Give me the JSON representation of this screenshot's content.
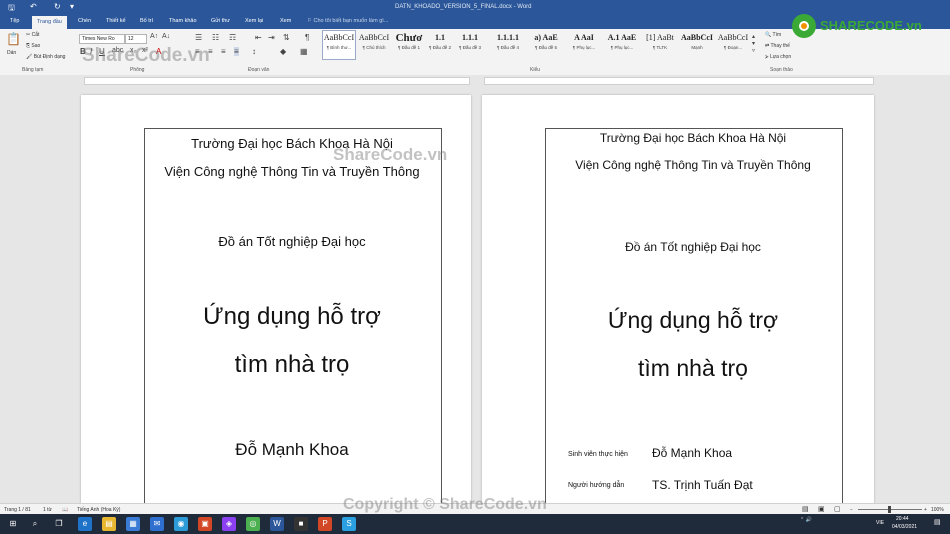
{
  "window": {
    "doc_title": "DATN_KHOADO_VERSION_5_FINAL.docx - Word"
  },
  "tabs": [
    "Tệp",
    "Trang đầu",
    "Chèn",
    "Thiết kế",
    "Bố trí",
    "Tham khảo",
    "Gửi thư",
    "Xem lại",
    "Xem"
  ],
  "active_tab": "Trang đầu",
  "tell_me": "Cho tôi biết bạn muốn làm gì...",
  "ribbon": {
    "clipboard": {
      "paste": "Dán",
      "cut": "Cắt",
      "copy": "Sao",
      "format_painter": "Bút Định dạng",
      "group": "Bảng tạm"
    },
    "font": {
      "name": "Times New Ro",
      "size": "12",
      "group": "Phông"
    },
    "paragraph": {
      "group": "Đoạn văn"
    },
    "styles": {
      "group": "Kiểu",
      "items": [
        {
          "sample": "AaBbCcI",
          "name": "¶ Bình thư..."
        },
        {
          "sample": "AaBbCcI",
          "name": "¶ Chú thích"
        },
        {
          "sample": "Chươ",
          "name": "¶ Đầu đề 1"
        },
        {
          "sample": "1.1",
          "name": "¶ Đầu đề 2"
        },
        {
          "sample": "1.1.1",
          "name": "¶ Đầu đề 3"
        },
        {
          "sample": "1.1.1.1",
          "name": "¶ Đầu đề 4"
        },
        {
          "sample": "a) AaE",
          "name": "¶ Đầu đề 5"
        },
        {
          "sample": "A  AaI",
          "name": "¶ Phụ lục..."
        },
        {
          "sample": "A.1 AaE",
          "name": "¶ Phụ lục..."
        },
        {
          "sample": "[1] AaBt",
          "name": "¶ TLTK"
        },
        {
          "sample": "AaBbCcI",
          "name": "Mạnh"
        },
        {
          "sample": "AaBbCcI",
          "name": "¶ Đoạn..."
        }
      ]
    },
    "editing": {
      "find": "Tìm",
      "replace": "Thay thế",
      "select": "Lựa chọn",
      "group": "Soạn thảo"
    }
  },
  "left_page": {
    "university": "Trường Đại học Bách Khoa Hà Nội",
    "institute": "Viện Công nghệ Thông Tin và Truyền Thông",
    "thesis": "Đồ án Tốt nghiệp Đại học",
    "title_line1": "Ứng dụng hỗ trợ",
    "title_line2": "tìm nhà trọ",
    "student": "Đỗ Mạnh Khoa"
  },
  "right_page": {
    "university": "Trường Đại học Bách Khoa Hà Nội",
    "institute": "Viện Công nghệ Thông Tin và Truyền Thông",
    "thesis": "Đồ án Tốt nghiệp Đại học",
    "title_line1": "Ứng dụng hỗ trợ",
    "title_line2": "tìm nhà trọ",
    "student_label": "Sinh viên thực hiện",
    "student": "Đỗ Mạnh Khoa",
    "advisor_label": "Người hướng dẫn",
    "advisor": "TS. Trịnh Tuấn Đạt"
  },
  "status": {
    "page": "Trang 1 / 81",
    "words": "1 từ",
    "language": "Tiếng Anh (Hoa Kỳ)",
    "zoom": "100%"
  },
  "taskbar": {
    "lang": "VIE",
    "time": "20:44",
    "date": "04/03/2021"
  },
  "watermarks": {
    "top": "ShareCode.vn",
    "middle": "ShareCode.vn",
    "bottom": "Copyright © ShareCode.vn",
    "logo": "SHARECODE.vn"
  },
  "colors": {
    "word_blue": "#2b579a",
    "logo_green": "#3aa935",
    "logo_orange": "#f39200"
  }
}
